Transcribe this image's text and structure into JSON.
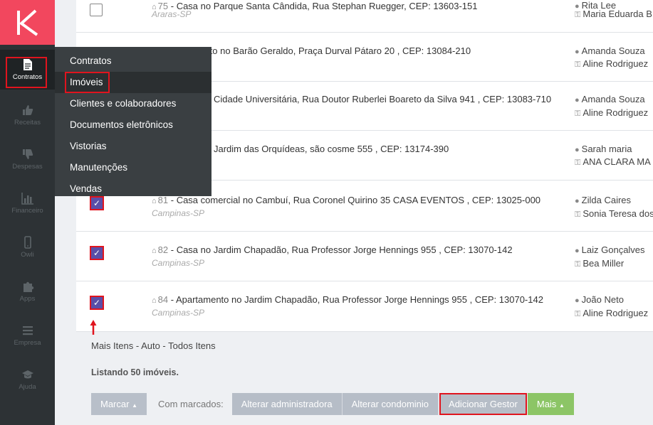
{
  "sidebar": {
    "items": [
      {
        "label": "Contratos",
        "icon": "document-icon",
        "active": true
      },
      {
        "label": "Receitas",
        "icon": "thumbs-up-icon"
      },
      {
        "label": "Despesas",
        "icon": "thumbs-down-icon"
      },
      {
        "label": "Financeiro",
        "icon": "bar-chart-icon"
      },
      {
        "label": "Owli",
        "icon": "mobile-icon"
      },
      {
        "label": "Apps",
        "icon": "puzzle-icon"
      },
      {
        "label": "Empresa",
        "icon": "menu-icon"
      },
      {
        "label": "Ajuda",
        "icon": "graduation-cap-icon"
      }
    ]
  },
  "flyout": {
    "items": [
      "Contratos",
      "Imóveis",
      "Clientes e colaboradores",
      "Documentos eletrônicos",
      "Vistorias",
      "Manutenções",
      "Vendas"
    ]
  },
  "rows": [
    {
      "id": "75",
      "address": "Casa no Parque Santa Cândida, Rua Stephan Ruegger, CEP: 13603-151",
      "city": "Araras-SP",
      "owner": "Rita Lee",
      "manager": "Maria Eduarda B",
      "checked": false
    },
    {
      "id": "",
      "address": "nento no Barão Geraldo, Praça Durval Pátaro 20 , CEP: 13084-210",
      "city": "",
      "owner": "Amanda Souza",
      "manager": "Aline Rodriguez",
      "checked": false
    },
    {
      "id": "",
      "address": "Cidade Universitária, Rua Doutor Ruberlei Boareto da Silva 941 , CEP: 13083-710",
      "city": "",
      "owner": "Amanda Souza",
      "manager": "Aline Rodriguez",
      "checked": false
    },
    {
      "id": "",
      "address": "Jardim das Orquídeas, são cosme 555 , CEP: 13174-390",
      "city": "",
      "owner": "Sarah maria",
      "manager": "ANA CLARA MA",
      "checked": false
    },
    {
      "id": "81",
      "address": "Casa comercial no Cambuí, Rua Coronel Quirino 35 CASA EVENTOS , CEP: 13025-000",
      "city": "Campinas-SP",
      "owner": "Zilda Caires",
      "manager": "Sonia Teresa dos",
      "checked": true
    },
    {
      "id": "82",
      "address": "Casa no Jardim Chapadão, Rua Professor Jorge Hennings 955 , CEP: 13070-142",
      "city": "Campinas-SP",
      "owner": "Laiz Gonçalves",
      "manager": "Bea Miller",
      "checked": true
    },
    {
      "id": "84",
      "address": "Apartamento no Jardim Chapadão, Rua Professor Jorge Hennings 955 , CEP: 13070-142",
      "city": "Campinas-SP",
      "owner": "João Neto",
      "manager": "Aline Rodriguez",
      "checked": true
    }
  ],
  "more_links": "Mais Itens - Auto - Todos Itens",
  "listing": "Listando 50 imóveis.",
  "actions": {
    "marcar": "Marcar",
    "with_marked": "Com marcados:",
    "alterar_admin": "Alterar administradora",
    "alterar_cond": "Alterar condominio",
    "adicionar_gestor": "Adicionar Gestor",
    "mais": "Mais"
  },
  "colors": {
    "brand": "#f2475e",
    "highlight": "#e0141e",
    "checkbox": "#5a4fa8",
    "mais": "#8cc566"
  }
}
